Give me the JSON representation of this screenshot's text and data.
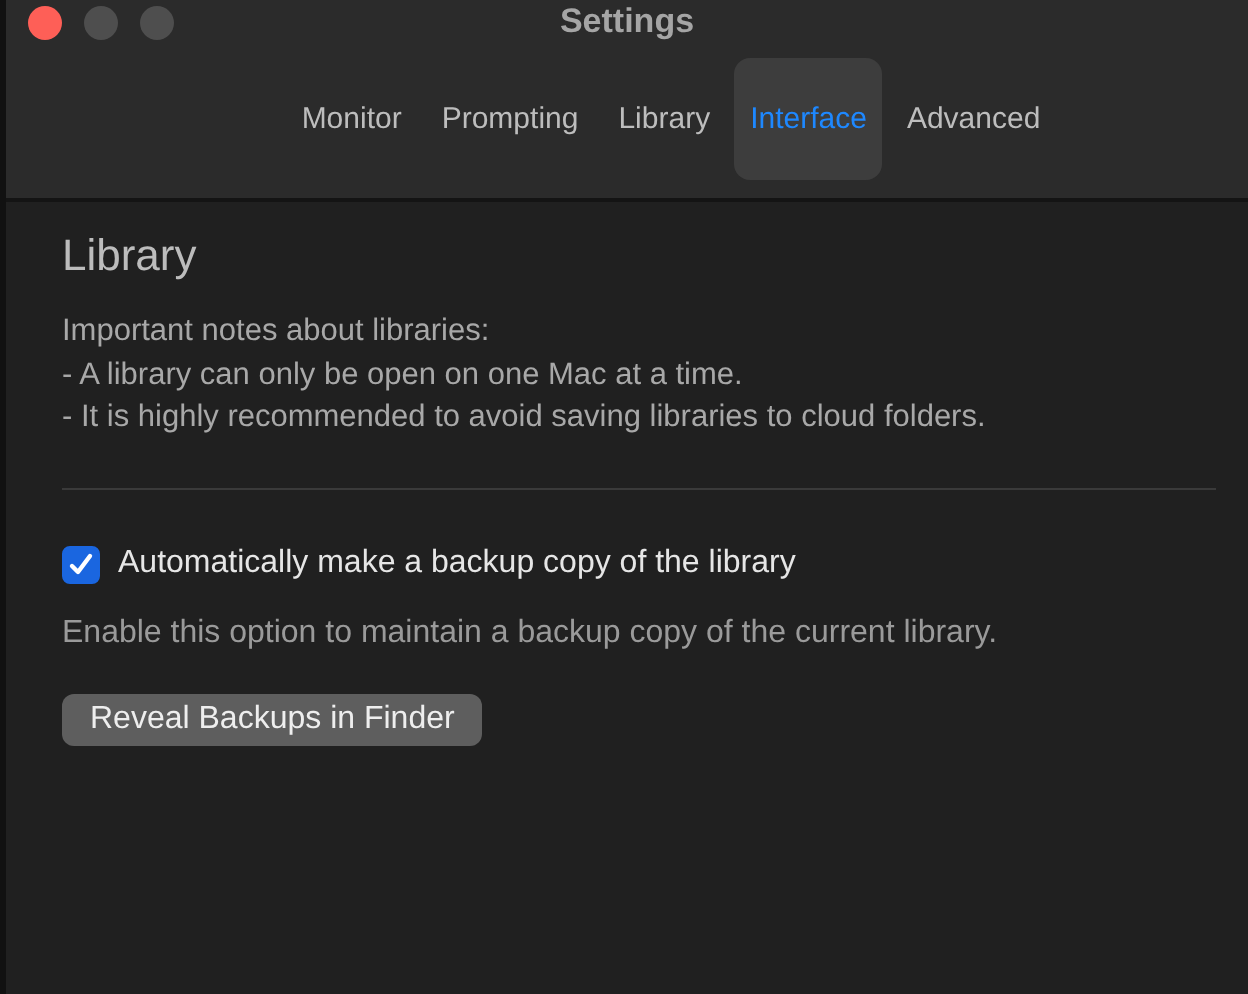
{
  "window": {
    "title": "Settings"
  },
  "tabs": [
    {
      "label": "Monitor",
      "selected": false
    },
    {
      "label": "Prompting",
      "selected": false
    },
    {
      "label": "Library",
      "selected": false
    },
    {
      "label": "Interface",
      "selected": true
    },
    {
      "label": "Advanced",
      "selected": false
    }
  ],
  "section": {
    "heading": "Library",
    "notes": [
      "Important notes about libraries:",
      "- A library can only be open on one Mac at a time.",
      "- It is highly recommended to avoid saving libraries to cloud folders."
    ]
  },
  "backup_option": {
    "label": "Automatically make a backup copy of the library",
    "checked": true,
    "description": "Enable this option to maintain a backup copy of the current library."
  },
  "buttons": [
    "Reveal Backups in Finder"
  ]
}
